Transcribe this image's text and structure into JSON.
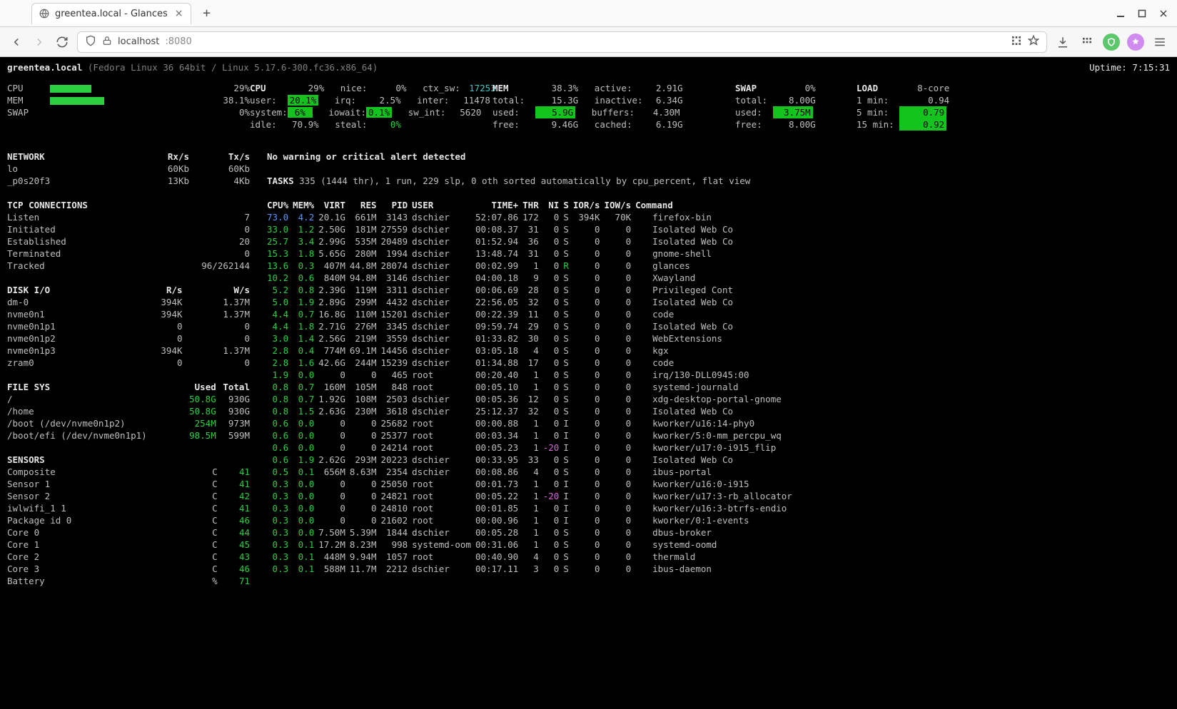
{
  "window": {
    "tab_title": "greentea.local - Glances",
    "url_host": "localhost",
    "url_port": ":8080"
  },
  "header": {
    "hostname": "greentea.local",
    "osline": "(Fedora Linux 36 64bit / Linux 5.17.6-300.fc36.x86_64)",
    "uptime": "Uptime: 7:15:31"
  },
  "summary": {
    "cpu_pct": 29,
    "mem_pct": 38.1,
    "swap_pct": 0
  },
  "cpu": {
    "total": "29%",
    "user": "20.1%",
    "system": "6%",
    "idle": "70.9%",
    "nice": "0%",
    "irq": "2.5%",
    "iowait": "0.1%",
    "steal": "0%",
    "ctx_sw": "17253",
    "inter": "11478",
    "sw_int": "5620"
  },
  "mem": {
    "pct": "38.3%",
    "total": "15.3G",
    "used": "5.9G",
    "free": "9.46G",
    "active": "2.91G",
    "inactive": "6.34G",
    "buffers": "4.30M",
    "cached": "6.19G"
  },
  "swap": {
    "pct": "0%",
    "total": "8.00G",
    "used": "3.75M",
    "free": "8.00G"
  },
  "load": {
    "cores": "8-core",
    "min1": "0.94",
    "min5": "0.79",
    "min15": "0.92"
  },
  "alert": "No warning or critical alert detected",
  "tasks_summary": "335 (1444 thr), 1 run, 229 slp, 0 oth sorted automatically by cpu_percent, flat view",
  "network": {
    "headers": [
      "NETWORK",
      "Rx/s",
      "Tx/s"
    ],
    "rows": [
      [
        "lo",
        "60Kb",
        "60Kb"
      ],
      [
        "_p0s20f3",
        "13Kb",
        "4Kb"
      ]
    ]
  },
  "tcp": {
    "title": "TCP CONNECTIONS",
    "rows": [
      [
        "Listen",
        "7"
      ],
      [
        "Initiated",
        "0"
      ],
      [
        "Established",
        "20"
      ],
      [
        "Terminated",
        "0"
      ],
      [
        "Tracked",
        "96/262144"
      ]
    ]
  },
  "diskio": {
    "headers": [
      "DISK I/O",
      "R/s",
      "W/s"
    ],
    "rows": [
      [
        "dm-0",
        "394K",
        "1.37M"
      ],
      [
        "nvme0n1",
        "394K",
        "1.37M"
      ],
      [
        "nvme0n1p1",
        "0",
        "0"
      ],
      [
        "nvme0n1p2",
        "0",
        "0"
      ],
      [
        "nvme0n1p3",
        "394K",
        "1.37M"
      ],
      [
        "zram0",
        "0",
        "0"
      ]
    ]
  },
  "fs": {
    "headers": [
      "FILE SYS",
      "Used",
      "Total"
    ],
    "rows": [
      [
        "/",
        "50.8G",
        "930G"
      ],
      [
        "/home",
        "50.8G",
        "930G"
      ],
      [
        "/boot (/dev/nvme0n1p2)",
        "254M",
        "973M"
      ],
      [
        "/boot/efi (/dev/nvme0n1p1)",
        "98.5M",
        "599M"
      ]
    ]
  },
  "sensors": {
    "title": "SENSORS",
    "rows": [
      [
        "Composite",
        "C",
        "41"
      ],
      [
        "Sensor 1",
        "C",
        "41"
      ],
      [
        "Sensor 2",
        "C",
        "42"
      ],
      [
        "iwlwifi_1 1",
        "C",
        "41"
      ],
      [
        "Package id 0",
        "C",
        "46"
      ],
      [
        "Core 0",
        "C",
        "44"
      ],
      [
        "Core 1",
        "C",
        "45"
      ],
      [
        "Core 2",
        "C",
        "43"
      ],
      [
        "Core 3",
        "C",
        "46"
      ],
      [
        "Battery",
        "%",
        "71"
      ]
    ]
  },
  "task_headers": [
    "CPU%",
    "MEM%",
    "VIRT",
    "RES",
    "PID",
    "USER",
    "TIME+",
    "THR",
    "NI",
    "S",
    "IOR/s",
    "IOW/s",
    "Command"
  ],
  "task_rows": [
    {
      "cpu": "73.0",
      "mem": "4.2",
      "virt": "20.1G",
      "res": "661M",
      "pid": "3143",
      "user": "dschier",
      "time": "52:07.86",
      "thr": "172",
      "ni": "0",
      "s": "S",
      "ior": "394K",
      "iow": "70K",
      "cmd": "firefox-bin",
      "cpu_blue": true,
      "mem_blue": true
    },
    {
      "cpu": "33.0",
      "mem": "1.2",
      "virt": "2.50G",
      "res": "181M",
      "pid": "27559",
      "user": "dschier",
      "time": "00:08.37",
      "thr": "31",
      "ni": "0",
      "s": "S",
      "ior": "0",
      "iow": "0",
      "cmd": "Isolated Web Co"
    },
    {
      "cpu": "25.7",
      "mem": "3.4",
      "virt": "2.99G",
      "res": "535M",
      "pid": "20489",
      "user": "dschier",
      "time": "01:52.94",
      "thr": "36",
      "ni": "0",
      "s": "S",
      "ior": "0",
      "iow": "0",
      "cmd": "Isolated Web Co"
    },
    {
      "cpu": "15.3",
      "mem": "1.8",
      "virt": "5.65G",
      "res": "280M",
      "pid": "1994",
      "user": "dschier",
      "time": "13:48.74",
      "thr": "31",
      "ni": "0",
      "s": "S",
      "ior": "0",
      "iow": "0",
      "cmd": "gnome-shell"
    },
    {
      "cpu": "13.6",
      "mem": "0.3",
      "virt": "407M",
      "res": "44.8M",
      "pid": "28074",
      "user": "dschier",
      "time": "00:02.99",
      "thr": "1",
      "ni": "0",
      "s": "R",
      "ior": "0",
      "iow": "0",
      "cmd": "glances",
      "s_green": true
    },
    {
      "cpu": "10.2",
      "mem": "0.6",
      "virt": "840M",
      "res": "94.8M",
      "pid": "3146",
      "user": "dschier",
      "time": "04:00.18",
      "thr": "9",
      "ni": "0",
      "s": "S",
      "ior": "0",
      "iow": "0",
      "cmd": "Xwayland"
    },
    {
      "cpu": "5.2",
      "mem": "0.8",
      "virt": "2.39G",
      "res": "119M",
      "pid": "3311",
      "user": "dschier",
      "time": "00:06.69",
      "thr": "28",
      "ni": "0",
      "s": "S",
      "ior": "0",
      "iow": "0",
      "cmd": "Privileged Cont"
    },
    {
      "cpu": "5.0",
      "mem": "1.9",
      "virt": "2.89G",
      "res": "299M",
      "pid": "4432",
      "user": "dschier",
      "time": "22:56.05",
      "thr": "32",
      "ni": "0",
      "s": "S",
      "ior": "0",
      "iow": "0",
      "cmd": "Isolated Web Co"
    },
    {
      "cpu": "4.4",
      "mem": "0.7",
      "virt": "16.8G",
      "res": "110M",
      "pid": "15201",
      "user": "dschier",
      "time": "00:22.39",
      "thr": "11",
      "ni": "0",
      "s": "S",
      "ior": "0",
      "iow": "0",
      "cmd": "code"
    },
    {
      "cpu": "4.4",
      "mem": "1.8",
      "virt": "2.71G",
      "res": "276M",
      "pid": "3345",
      "user": "dschier",
      "time": "09:59.74",
      "thr": "29",
      "ni": "0",
      "s": "S",
      "ior": "0",
      "iow": "0",
      "cmd": "Isolated Web Co"
    },
    {
      "cpu": "3.0",
      "mem": "1.4",
      "virt": "2.56G",
      "res": "219M",
      "pid": "3559",
      "user": "dschier",
      "time": "01:33.82",
      "thr": "30",
      "ni": "0",
      "s": "S",
      "ior": "0",
      "iow": "0",
      "cmd": "WebExtensions"
    },
    {
      "cpu": "2.8",
      "mem": "0.4",
      "virt": "774M",
      "res": "69.1M",
      "pid": "14456",
      "user": "dschier",
      "time": "03:05.18",
      "thr": "4",
      "ni": "0",
      "s": "S",
      "ior": "0",
      "iow": "0",
      "cmd": "kgx"
    },
    {
      "cpu": "2.8",
      "mem": "1.6",
      "virt": "42.6G",
      "res": "244M",
      "pid": "15239",
      "user": "dschier",
      "time": "01:34.88",
      "thr": "17",
      "ni": "0",
      "s": "S",
      "ior": "0",
      "iow": "0",
      "cmd": "code"
    },
    {
      "cpu": "1.9",
      "mem": "0.0",
      "virt": "0",
      "res": "0",
      "pid": "465",
      "user": "root",
      "time": "00:20.40",
      "thr": "1",
      "ni": "0",
      "s": "S",
      "ior": "0",
      "iow": "0",
      "cmd": "irq/130-DLL0945:00"
    },
    {
      "cpu": "0.8",
      "mem": "0.7",
      "virt": "160M",
      "res": "105M",
      "pid": "848",
      "user": "root",
      "time": "00:05.10",
      "thr": "1",
      "ni": "0",
      "s": "S",
      "ior": "0",
      "iow": "0",
      "cmd": "systemd-journald"
    },
    {
      "cpu": "0.8",
      "mem": "0.7",
      "virt": "1.92G",
      "res": "108M",
      "pid": "2503",
      "user": "dschier",
      "time": "00:05.36",
      "thr": "12",
      "ni": "0",
      "s": "S",
      "ior": "0",
      "iow": "0",
      "cmd": "xdg-desktop-portal-gnome"
    },
    {
      "cpu": "0.8",
      "mem": "1.5",
      "virt": "2.63G",
      "res": "230M",
      "pid": "3618",
      "user": "dschier",
      "time": "25:12.37",
      "thr": "32",
      "ni": "0",
      "s": "S",
      "ior": "0",
      "iow": "0",
      "cmd": "Isolated Web Co"
    },
    {
      "cpu": "0.6",
      "mem": "0.0",
      "virt": "0",
      "res": "0",
      "pid": "25682",
      "user": "root",
      "time": "00:00.88",
      "thr": "1",
      "ni": "0",
      "s": "I",
      "ior": "0",
      "iow": "0",
      "cmd": "kworker/u16:14-phy0"
    },
    {
      "cpu": "0.6",
      "mem": "0.0",
      "virt": "0",
      "res": "0",
      "pid": "25377",
      "user": "root",
      "time": "00:03.34",
      "thr": "1",
      "ni": "0",
      "s": "I",
      "ior": "0",
      "iow": "0",
      "cmd": "kworker/5:0-mm_percpu_wq"
    },
    {
      "cpu": "0.6",
      "mem": "0.0",
      "virt": "0",
      "res": "0",
      "pid": "24214",
      "user": "root",
      "time": "00:05.23",
      "thr": "1",
      "ni": "-20",
      "s": "I",
      "ior": "0",
      "iow": "0",
      "cmd": "kworker/u17:0-i915_flip",
      "ni_mag": true
    },
    {
      "cpu": "0.6",
      "mem": "1.9",
      "virt": "2.62G",
      "res": "293M",
      "pid": "20223",
      "user": "dschier",
      "time": "00:33.95",
      "thr": "33",
      "ni": "0",
      "s": "S",
      "ior": "0",
      "iow": "0",
      "cmd": "Isolated Web Co"
    },
    {
      "cpu": "0.5",
      "mem": "0.1",
      "virt": "656M",
      "res": "8.63M",
      "pid": "2354",
      "user": "dschier",
      "time": "00:08.86",
      "thr": "4",
      "ni": "0",
      "s": "S",
      "ior": "0",
      "iow": "0",
      "cmd": "ibus-portal"
    },
    {
      "cpu": "0.3",
      "mem": "0.0",
      "virt": "0",
      "res": "0",
      "pid": "25050",
      "user": "root",
      "time": "00:01.73",
      "thr": "1",
      "ni": "0",
      "s": "I",
      "ior": "0",
      "iow": "0",
      "cmd": "kworker/u16:0-i915"
    },
    {
      "cpu": "0.3",
      "mem": "0.0",
      "virt": "0",
      "res": "0",
      "pid": "24821",
      "user": "root",
      "time": "00:05.22",
      "thr": "1",
      "ni": "-20",
      "s": "I",
      "ior": "0",
      "iow": "0",
      "cmd": "kworker/u17:3-rb_allocator",
      "ni_mag": true
    },
    {
      "cpu": "0.3",
      "mem": "0.0",
      "virt": "0",
      "res": "0",
      "pid": "24810",
      "user": "root",
      "time": "00:01.85",
      "thr": "1",
      "ni": "0",
      "s": "I",
      "ior": "0",
      "iow": "0",
      "cmd": "kworker/u16:3-btrfs-endio"
    },
    {
      "cpu": "0.3",
      "mem": "0.0",
      "virt": "0",
      "res": "0",
      "pid": "21602",
      "user": "root",
      "time": "00:00.96",
      "thr": "1",
      "ni": "0",
      "s": "I",
      "ior": "0",
      "iow": "0",
      "cmd": "kworker/0:1-events"
    },
    {
      "cpu": "0.3",
      "mem": "0.0",
      "virt": "7.50M",
      "res": "5.39M",
      "pid": "1844",
      "user": "dschier",
      "time": "00:05.28",
      "thr": "1",
      "ni": "0",
      "s": "S",
      "ior": "0",
      "iow": "0",
      "cmd": "dbus-broker"
    },
    {
      "cpu": "0.3",
      "mem": "0.1",
      "virt": "17.2M",
      "res": "8.23M",
      "pid": "998",
      "user": "systemd-oom",
      "time": "00:31.06",
      "thr": "1",
      "ni": "0",
      "s": "S",
      "ior": "0",
      "iow": "0",
      "cmd": "systemd-oomd"
    },
    {
      "cpu": "0.3",
      "mem": "0.1",
      "virt": "448M",
      "res": "9.94M",
      "pid": "1057",
      "user": "root",
      "time": "00:40.90",
      "thr": "4",
      "ni": "0",
      "s": "S",
      "ior": "0",
      "iow": "0",
      "cmd": "thermald"
    },
    {
      "cpu": "0.3",
      "mem": "0.1",
      "virt": "588M",
      "res": "11.7M",
      "pid": "2212",
      "user": "dschier",
      "time": "00:17.11",
      "thr": "3",
      "ni": "0",
      "s": "S",
      "ior": "0",
      "iow": "0",
      "cmd": "ibus-daemon"
    }
  ]
}
